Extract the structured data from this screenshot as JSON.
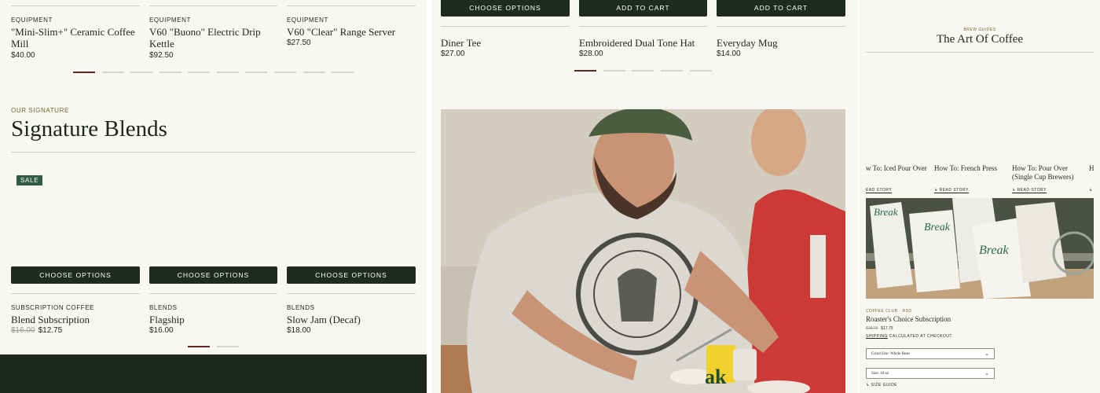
{
  "panel1": {
    "equipment_products": [
      {
        "category": "EQUIPMENT",
        "title": "\"Mini-Slim+\" Ceramic Coffee Mill",
        "price": "$40.00"
      },
      {
        "category": "EQUIPMENT",
        "title": "V60 \"Buono\" Electric Drip Kettle",
        "price": "$92.50"
      },
      {
        "category": "EQUIPMENT",
        "title": "V60 \"Clear\" Range Server",
        "price": "$27.50"
      }
    ],
    "eyebrow": "OUR SIGNATURE",
    "heading": "Signature Blends",
    "sale_badge": "SALE",
    "choose_options": "CHOOSE OPTIONS",
    "blends": [
      {
        "category": "SUBSCRIPTION COFFEE",
        "title": "Blend Subscription",
        "old_price": "$16.00",
        "price": "$12.75"
      },
      {
        "category": "BLENDS",
        "title": "Flagship",
        "price": "$16.00"
      },
      {
        "category": "BLENDS",
        "title": "Slow Jam (Decaf)",
        "price": "$18.00"
      }
    ],
    "colors": {
      "footer": "#1e2620",
      "accent": "#5a2a20",
      "badge": "#2f5a46",
      "eyebrow": "#6b6a2a"
    }
  },
  "panel2": {
    "buttons": [
      "CHOOSE OPTIONS",
      "ADD TO CART",
      "ADD TO CART"
    ],
    "products": [
      {
        "title": "Diner Tee",
        "price": "$27.00"
      },
      {
        "title": "Embroidered Dual Tone Hat",
        "price": "$28.00"
      },
      {
        "title": "Everyday Mug",
        "price": "$14.00"
      }
    ],
    "cup_logo_text": "ak"
  },
  "panel3": {
    "eyebrow": "BREW GUIDES",
    "heading": "The Art Of Coffee",
    "stories": [
      {
        "title": "w To: Iced Pour Over",
        "link": "EAD STORY"
      },
      {
        "title": "How To: French Press",
        "link": "↳ READ STORY"
      },
      {
        "title": "How To: Pour Over (Single Cup Brewers)",
        "link": "↳ READ STORY"
      },
      {
        "title": "H",
        "link": "↳"
      }
    ],
    "bag_brand": "Break",
    "product_tags": "COFFEE CLUB · RSD",
    "product_title": "Roaster's Choice Subscription",
    "old_price": "$18.75",
    "price": "$17.75",
    "shipping_note_link": "SHIPPING",
    "shipping_note": " CALCULATED AT CHECKOUT.",
    "select_grind": "Grind Size: Whole Bean",
    "select_size": "Size: 10 oz",
    "size_guide": "↳ SIZE GUIDE"
  }
}
